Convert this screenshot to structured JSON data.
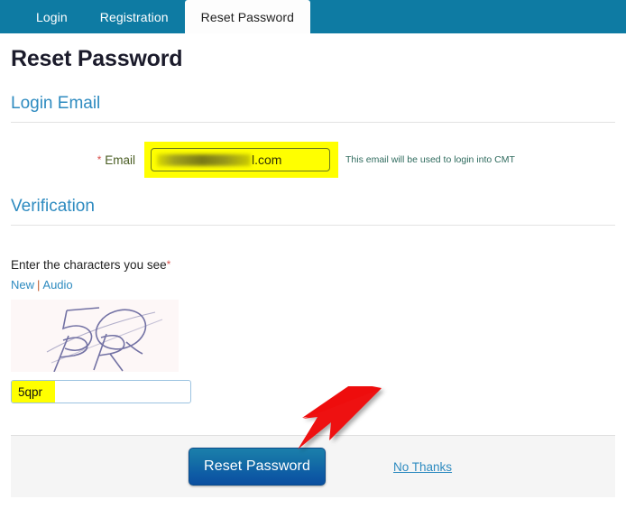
{
  "tabs": [
    {
      "label": "Login",
      "active": false
    },
    {
      "label": "Registration",
      "active": false
    },
    {
      "label": "Reset Password",
      "active": true
    }
  ],
  "page": {
    "title": "Reset Password"
  },
  "sections": {
    "login_email": {
      "heading": "Login Email",
      "email_label": "Email",
      "required_marker": "*",
      "email_value": "l.com",
      "email_hint": "This email will be used to login into CMT"
    },
    "verification": {
      "heading": "Verification",
      "prompt": "Enter the characters you see",
      "required_marker": "*",
      "link_new": "New",
      "link_separator": "|",
      "link_audio": "Audio",
      "captcha_text": "5QPR",
      "captcha_input_value": "5qpr"
    }
  },
  "footer": {
    "submit_label": "Reset Password",
    "cancel_label": "No Thanks"
  },
  "annotation": {
    "arrow_color": "#ee1111",
    "arrow_target": "Reset Password"
  },
  "colors": {
    "tabbar_teal": "#0e7ba3",
    "heading_blue": "#2e8bc0",
    "highlight_yellow": "#ffff00",
    "button_blue": "#0e5ca5",
    "footer_gray": "#f5f5f5"
  }
}
